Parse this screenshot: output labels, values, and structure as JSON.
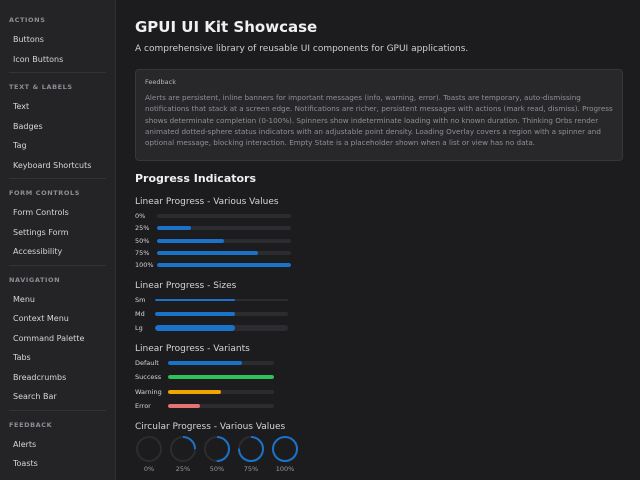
{
  "sidebar": {
    "sections": [
      {
        "title": "ACTIONS",
        "items": [
          "Buttons",
          "Icon Buttons"
        ]
      },
      {
        "title": "TEXT & LABELS",
        "items": [
          "Text",
          "Badges",
          "Tag",
          "Keyboard Shortcuts"
        ]
      },
      {
        "title": "FORM CONTROLS",
        "items": [
          "Form Controls",
          "Settings Form",
          "Accessibility"
        ]
      },
      {
        "title": "NAVIGATION",
        "items": [
          "Menu",
          "Context Menu",
          "Command Palette",
          "Tabs",
          "Breadcrumbs",
          "Search Bar"
        ]
      },
      {
        "title": "FEEDBACK",
        "items": [
          "Alerts",
          "Toasts"
        ]
      }
    ]
  },
  "main": {
    "title": "GPUI UI Kit Showcase",
    "subtitle": "A comprehensive library of reusable UI components for GPUI applications.",
    "info_card": {
      "label": "Feedback",
      "body": "Alerts are persistent, inline banners for important messages (info, warning, error). Toasts are temporary, auto-dismissing notifications that stack at a screen edge. Notifications are richer, persistent messages with actions (mark read, dismiss). Progress shows determinate completion (0-100%). Spinners show indeterminate loading with no known duration. Thinking Orbs render animated dotted-sphere status indicators with an adjustable point density. Loading Overlay covers a region with a spinner and optional message, blocking interaction. Empty State is a placeholder shown when a list or view has no data."
    },
    "progress_heading": "Progress Indicators",
    "linear_values": {
      "title": "Linear Progress - Various Values",
      "rows": [
        {
          "label": "0%",
          "value": 0
        },
        {
          "label": "25%",
          "value": 0.25
        },
        {
          "label": "50%",
          "value": 0.5
        },
        {
          "label": "75%",
          "value": 0.75
        },
        {
          "label": "100%",
          "value": 1.0
        }
      ]
    },
    "linear_sizes": {
      "title": "Linear Progress - Sizes",
      "rows": [
        {
          "label": "Sm",
          "value": 0.6,
          "size": "sm"
        },
        {
          "label": "Md",
          "value": 0.6,
          "size": "md"
        },
        {
          "label": "Lg",
          "value": 0.6,
          "size": "lg"
        }
      ]
    },
    "linear_variants": {
      "title": "Linear Progress - Variants",
      "rows": [
        {
          "label": "Default",
          "value": 0.7,
          "color": "#1a73c9"
        },
        {
          "label": "Success",
          "value": 1.0,
          "color": "#2ec25a"
        },
        {
          "label": "Warning",
          "value": 0.5,
          "color": "#f0a500"
        },
        {
          "label": "Error",
          "value": 0.3,
          "color": "#e57373"
        }
      ]
    },
    "circular_values": {
      "title": "Circular Progress - Various Values",
      "items": [
        {
          "label": "0%",
          "value": 0
        },
        {
          "label": "25%",
          "value": 0.25
        },
        {
          "label": "50%",
          "value": 0.5
        },
        {
          "label": "75%",
          "value": 0.75
        },
        {
          "label": "100%",
          "value": 1.0
        }
      ]
    }
  },
  "colors": {
    "accent": "#1a73c9",
    "track": "#2c2c30",
    "success": "#2ec25a",
    "warning": "#f0a500",
    "error": "#e57373"
  }
}
